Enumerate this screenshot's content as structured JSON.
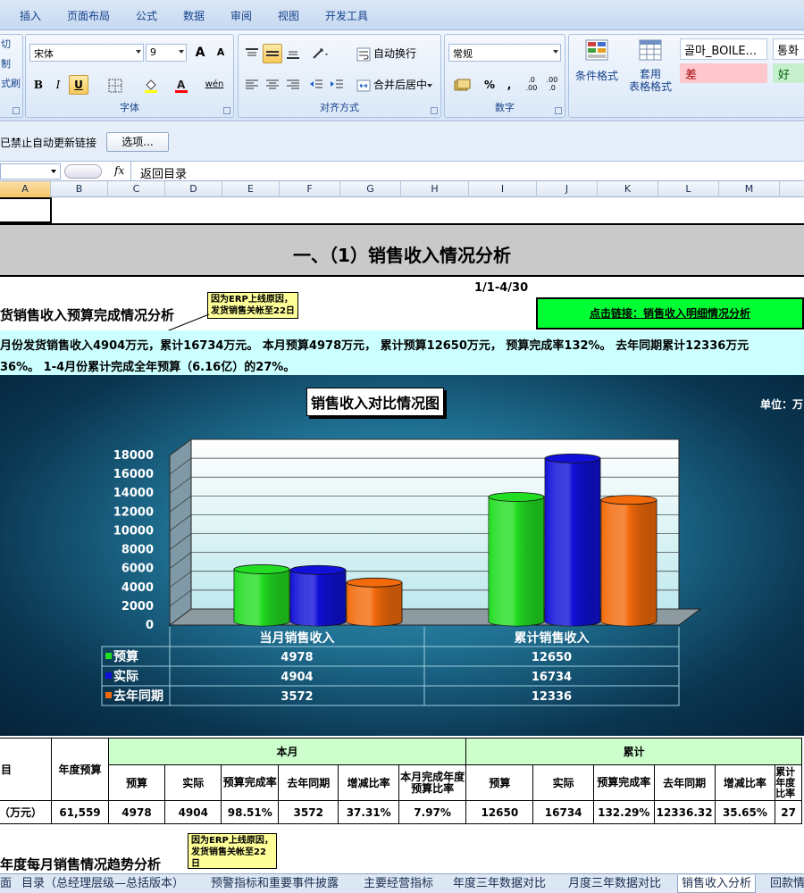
{
  "ribbon": {
    "tabs": [
      "插入",
      "页面布局",
      "公式",
      "数据",
      "审阅",
      "视图",
      "开发工具"
    ],
    "clipboard_fragments": [
      "切",
      "制",
      "式刷"
    ],
    "font": {
      "name": "宋体",
      "size": "9",
      "grow": "A",
      "shrink": "A",
      "bold": "B",
      "italic": "I",
      "underline": "U",
      "phonetic": "wén",
      "group_label": "字体"
    },
    "alignment": {
      "wrap_text": "自动换行",
      "merge_center": "合并后居中",
      "group_label": "对齐方式"
    },
    "number": {
      "format": "常规",
      "percent": "%",
      "comma": ",",
      "increase_decimal": ".0\n.00",
      "decrease_decimal": ".00\n.0",
      "group_label": "数字"
    },
    "styles": {
      "conditional_format": "条件格式",
      "format_table_line1": "套用",
      "format_table_line2": "表格格式",
      "style_cell_1": "골마_BOILE...",
      "style_cell_2": "통화",
      "style_bad": "差",
      "style_good": "好"
    }
  },
  "message_bar": {
    "text": "已禁止自动更新链接",
    "options_button": "选项..."
  },
  "formula_bar": {
    "fx": "fx",
    "content": "返回目录"
  },
  "columns": [
    "A",
    "B",
    "C",
    "D",
    "E",
    "F",
    "G",
    "H",
    "I",
    "J",
    "K",
    "L",
    "M"
  ],
  "sheet": {
    "title": "一、（1）销售收入情况分析",
    "date_range": "1/1-4/30",
    "section1_heading": "货销售收入预算完成情况分析",
    "note1_line1": "因为ERP上线原因，",
    "note1_line2": "发货销售关帐至22日",
    "link_button": "点击链接：销售收入明细情况分析",
    "summary_line1": "月份发货销售收入4904万元，累计16734万元。   本月预算4978万元，  累计预算12650万元，  预算完成率132%。  去年同期累计12336万元",
    "summary_line2": "36%。   1-4月份累计完成全年预算（6.16亿）的27%。",
    "section2_heading": "年度每月销售情况趋势分析",
    "note2_line1": "因为ERP上线原因，",
    "note2_line2": "发货销售关帐至22",
    "note2_line3": "日"
  },
  "chart_data": {
    "type": "bar",
    "title": "销售收入对比情况图",
    "unit_label": "单位：万",
    "categories": [
      "当月销售收入",
      "累计销售收入"
    ],
    "series": [
      {
        "name": "预算",
        "values": [
          4978,
          12650
        ],
        "color": "#22dd22"
      },
      {
        "name": "实际",
        "values": [
          4904,
          16734
        ],
        "color": "#1010d8"
      },
      {
        "name": "去年同期",
        "values": [
          3572,
          12336
        ],
        "color": "#f26a0a"
      }
    ],
    "ylim": [
      0,
      18000
    ],
    "yticks": [
      "0",
      "2000",
      "4000",
      "6000",
      "8000",
      "10000",
      "12000",
      "14000",
      "16000",
      "18000"
    ],
    "grid": true,
    "legend": "data-table-bottom"
  },
  "table": {
    "row_header": "目",
    "annual_budget_header": "年度预算",
    "month_group": "本月",
    "cumulative_group": "累计",
    "month_cols": [
      "预算",
      "实际",
      "预算完成率",
      "去年同期",
      "增减比率",
      "本月完成年度预算比率"
    ],
    "cumulative_cols": [
      "预算",
      "实际",
      "预算完成率",
      "去年同期",
      "增减比率",
      "累计年度比率"
    ],
    "row_label": "（万元）",
    "annual_budget": "61,559",
    "month_values": [
      "4978",
      "4904",
      "98.51%",
      "3572",
      "37.31%",
      "7.97%"
    ],
    "cumulative_values": [
      "12650",
      "16734",
      "132.29%",
      "12336.32",
      "35.65%",
      "27"
    ]
  },
  "sheet_tabs": [
    "面",
    "目录（总经理层级—总括版本）",
    "预警指标和重要事件披露",
    "主要经营指标",
    "年度三年数据对比",
    "月度三年数据对比",
    "销售收入分析",
    "回款情"
  ],
  "active_sheet_tab": "销售收入分析"
}
